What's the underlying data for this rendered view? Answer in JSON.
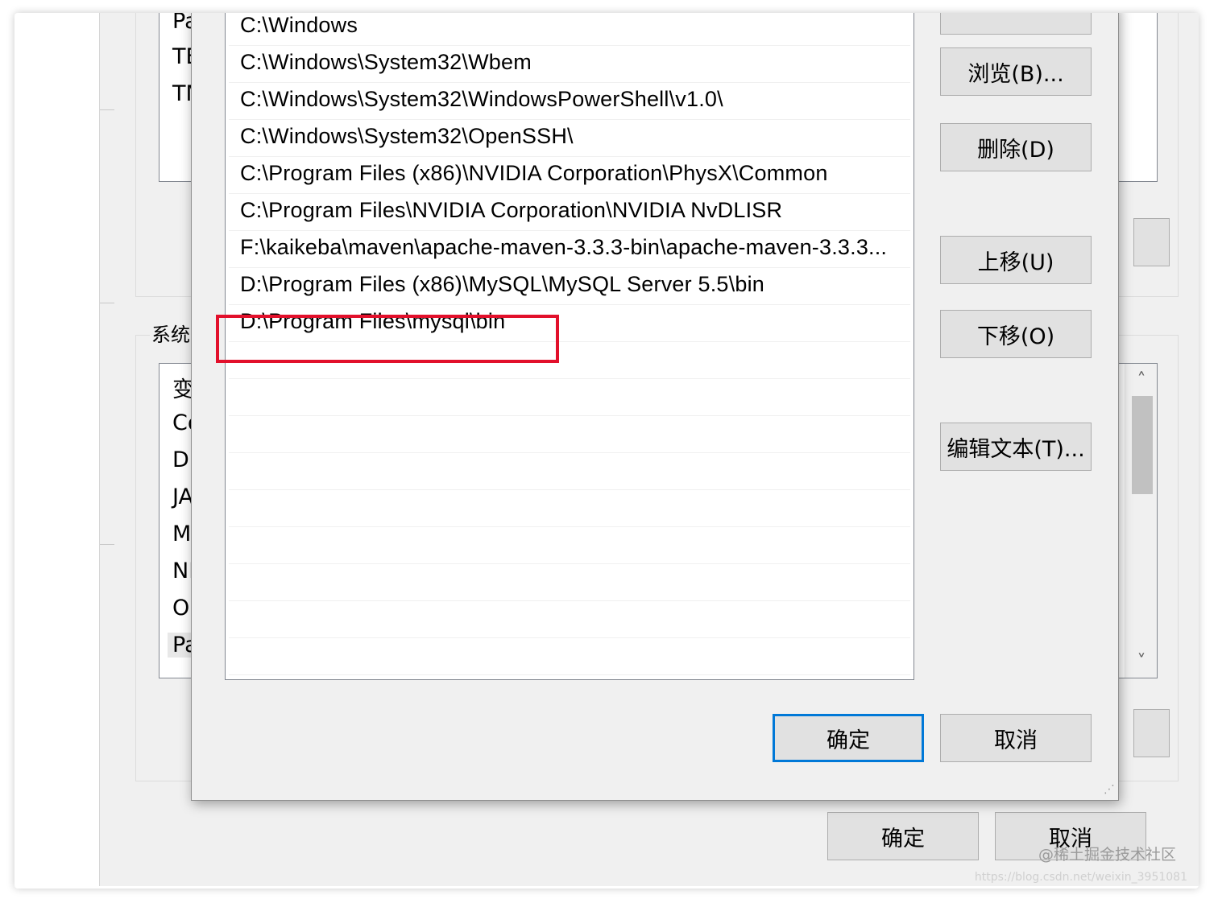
{
  "path_entries": [
    "C:\\Windows",
    "C:\\Windows\\System32\\Wbem",
    "C:\\Windows\\System32\\WindowsPowerShell\\v1.0\\",
    "C:\\Windows\\System32\\OpenSSH\\",
    "C:\\Program Files (x86)\\NVIDIA Corporation\\PhysX\\Common",
    "C:\\Program Files\\NVIDIA Corporation\\NVIDIA NvDLISR",
    "F:\\kaikeba\\maven\\apache-maven-3.3.3-bin\\apache-maven-3.3.3...",
    "D:\\Program Files (x86)\\MySQL\\MySQL Server 5.5\\bin",
    "D:\\Program Files\\mysql\\bin"
  ],
  "highlight_color": "#e2102b",
  "focus_color": "#0078d7",
  "side_buttons": {
    "browse": "浏览(B)...",
    "delete": "删除(D)",
    "move_up": "上移(U)",
    "move_down": "下移(O)",
    "edit_text": "编辑文本(T)..."
  },
  "dialog_buttons": {
    "ok": "确定",
    "cancel": "取消"
  },
  "background_dialog": {
    "user_vars_partial": [
      "Pa",
      "TE",
      "TM"
    ],
    "system_vars_label": "系统",
    "system_vars_partial": [
      "变",
      "Co",
      "Dr",
      "JA",
      "M",
      "NI",
      "O",
      "Pa"
    ],
    "ok": "确定",
    "cancel": "取消"
  },
  "watermark": {
    "line1": "@稀土掘金技术社区",
    "line2": "https://blog.csdn.net/weixin_3951081"
  }
}
